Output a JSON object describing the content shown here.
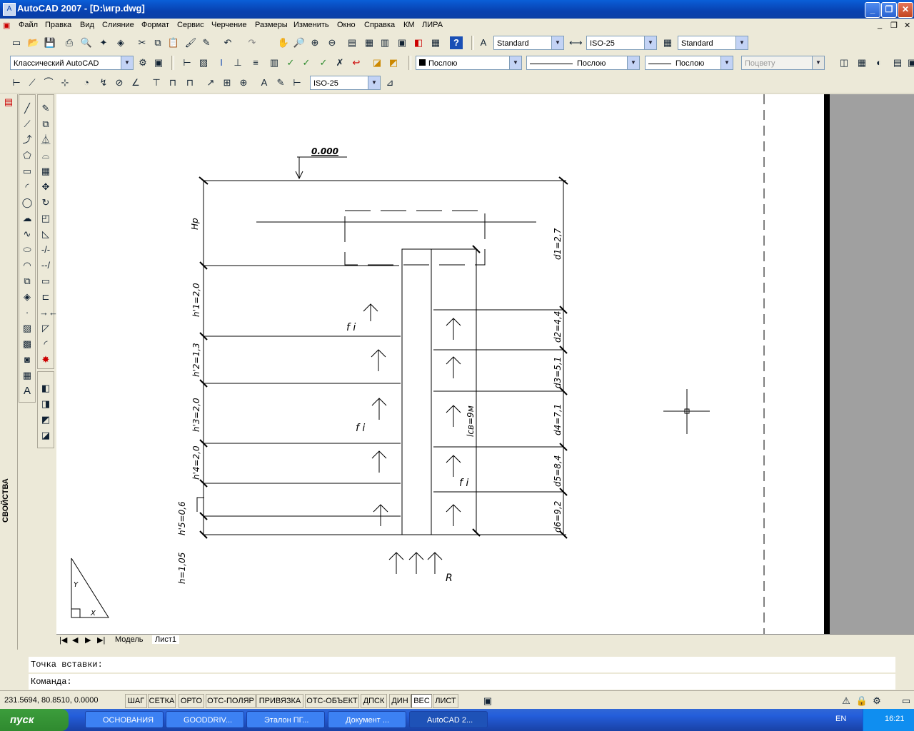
{
  "window": {
    "title": "AutoCAD 2007 - [D:\\игр.dwg]"
  },
  "menu": [
    "Файл",
    "Правка",
    "Вид",
    "Слияние",
    "Формат",
    "Сервис",
    "Черчение",
    "Размеры",
    "Изменить",
    "Окно",
    "Справка",
    "КМ",
    "ЛИРА"
  ],
  "toolbar1": {
    "text_style": "Standard",
    "dim_style": "ISO-25",
    "table_style": "Standard"
  },
  "toolbar2": {
    "workspace": "Классический AutoCAD",
    "layer_color": "Послою",
    "linetype": "Послою",
    "lineweight": "Послою",
    "plotstyle": "Поцвету"
  },
  "toolbar3": {
    "dim_style": "ISO-25"
  },
  "properties_label": "СВОЙСТВА",
  "drawing": {
    "elevation": "0.000",
    "labels": {
      "hp": "Hp",
      "h1": "h'1=2,0",
      "h2": "h'2=1,3",
      "h3": "h'3=2,0",
      "h4": "h'4=2,0",
      "h5": "h'5=0,6",
      "h": "h=1,05",
      "d1": "d1=2,7",
      "d2": "d2=4,4",
      "d3": "d3=5,1",
      "d4": "d4=7,1",
      "d5": "d5=8,4",
      "d6": "d6=9,2",
      "fi1": "f i",
      "fi2": "f i",
      "fi3": "f i",
      "lcv": "lcв=9м",
      "r": "R"
    }
  },
  "tabs": {
    "model": "Модель",
    "layout": "Лист1"
  },
  "command": {
    "line1": "Точка вставки:",
    "prompt": "Команда:"
  },
  "status": {
    "coords": "231.5694, 80.8510, 0.0000",
    "buttons": [
      "ШАГ",
      "СЕТКА",
      "ОРТО",
      "ОТС-ПОЛЯР",
      "ПРИВЯЗКА",
      "ОТС-ОБЪЕКТ",
      "ДПСК",
      "ДИН",
      "ВЕС",
      "ЛИСТ"
    ]
  },
  "taskbar": {
    "start": "пуск",
    "tasks": [
      "ОСНОВАНИЯ",
      "GOODDRIV...",
      "Эталон ПГ...",
      "Документ ...",
      "AutoCAD 2..."
    ],
    "lang": "EN",
    "time": "16:21"
  }
}
